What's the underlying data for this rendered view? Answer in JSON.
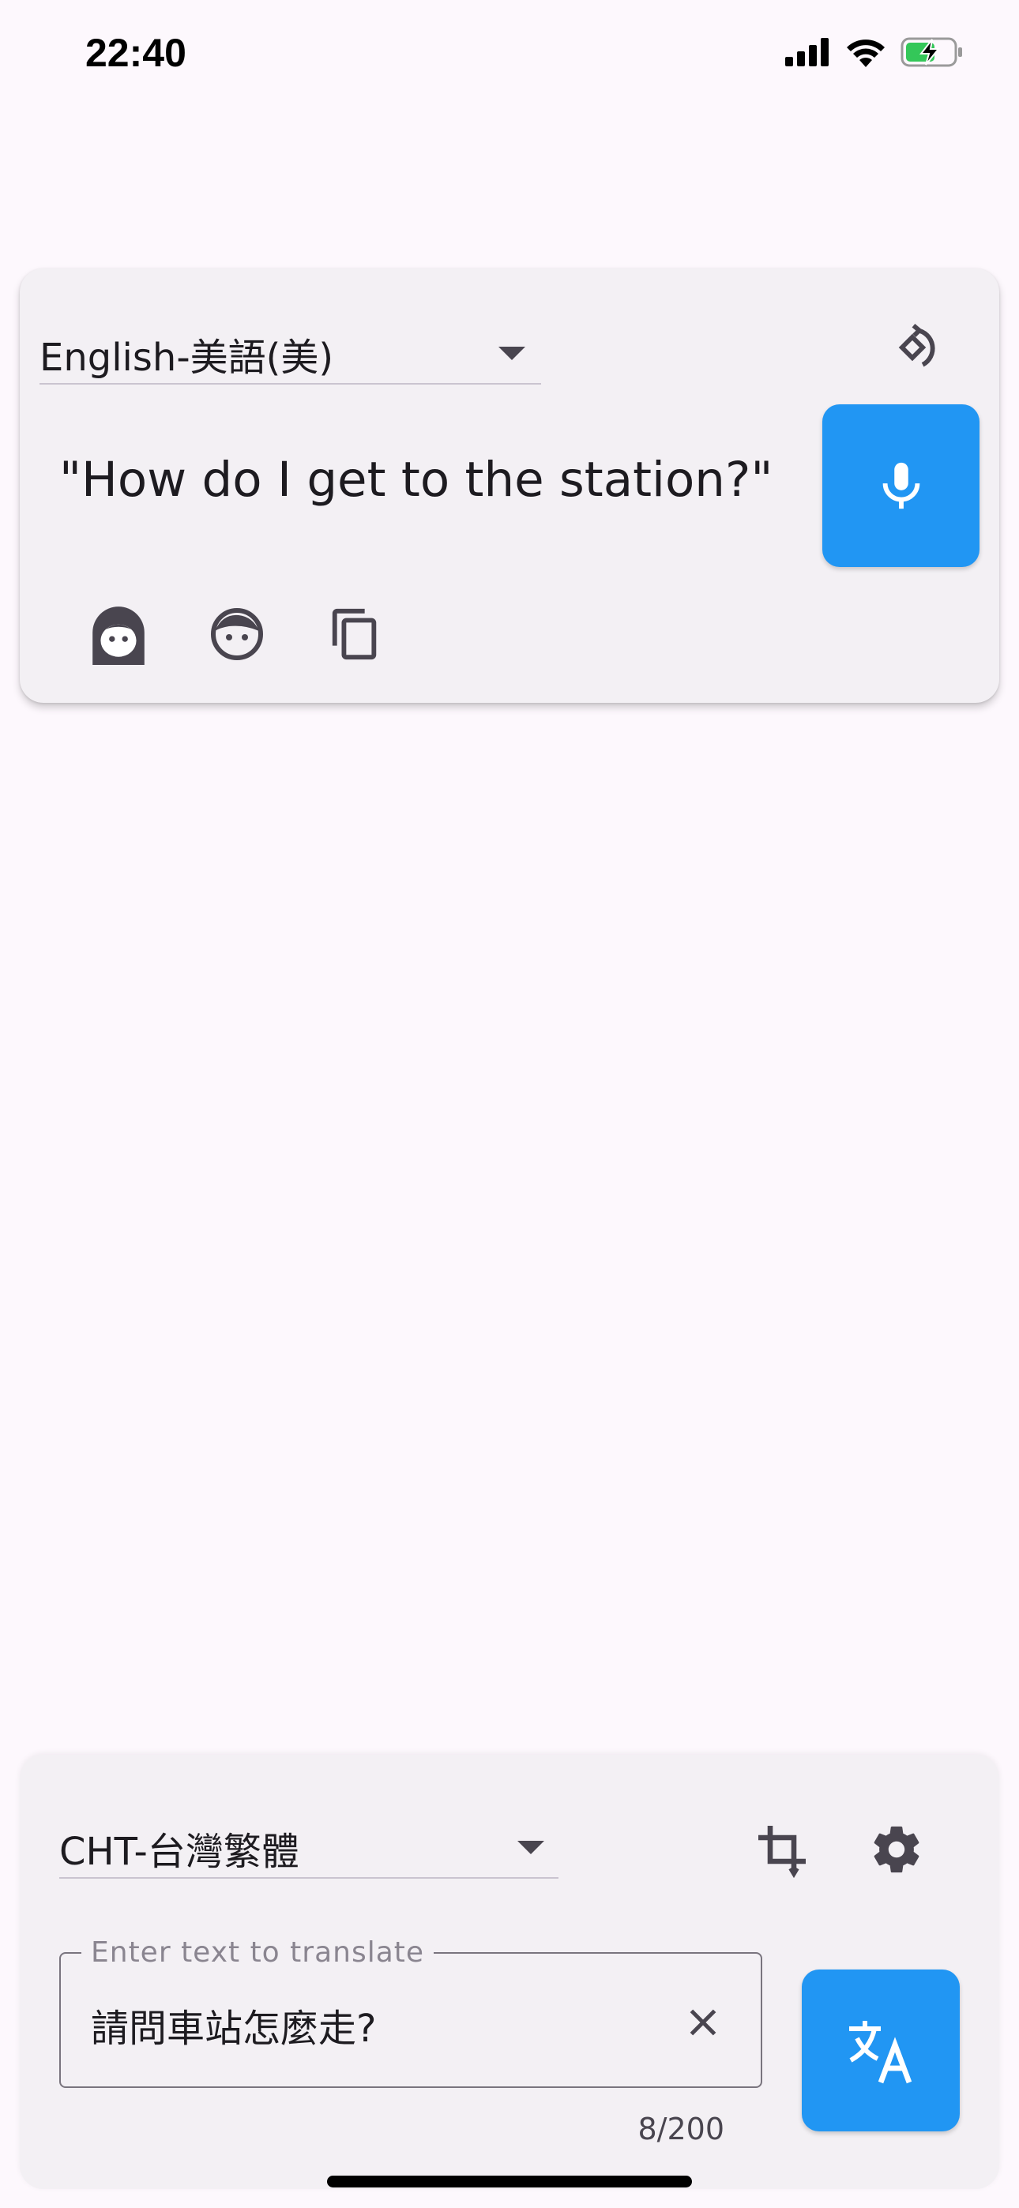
{
  "status_bar": {
    "time": "22:40"
  },
  "source_panel": {
    "language": "English-美語(美)",
    "text": "\"How do I get to the station?\"",
    "icons": {
      "swap": "swap-direction-icon",
      "microphone": "microphone-icon",
      "female_voice": "female-voice-icon",
      "male_voice": "male-voice-icon",
      "copy": "copy-icon"
    }
  },
  "target_panel": {
    "language": "CHT-台灣繁體",
    "input": {
      "label": "Enter text to translate",
      "value": "請問車站怎麼走?",
      "counter": "8/200"
    },
    "icons": {
      "crop": "crop-icon",
      "settings": "gear-icon",
      "clear": "close-icon",
      "translate": "translate-icon"
    }
  },
  "colors": {
    "accent": "#2196f3",
    "background": "#fdf8fd",
    "card": "#f3f0f4",
    "icon": "#49454f"
  }
}
